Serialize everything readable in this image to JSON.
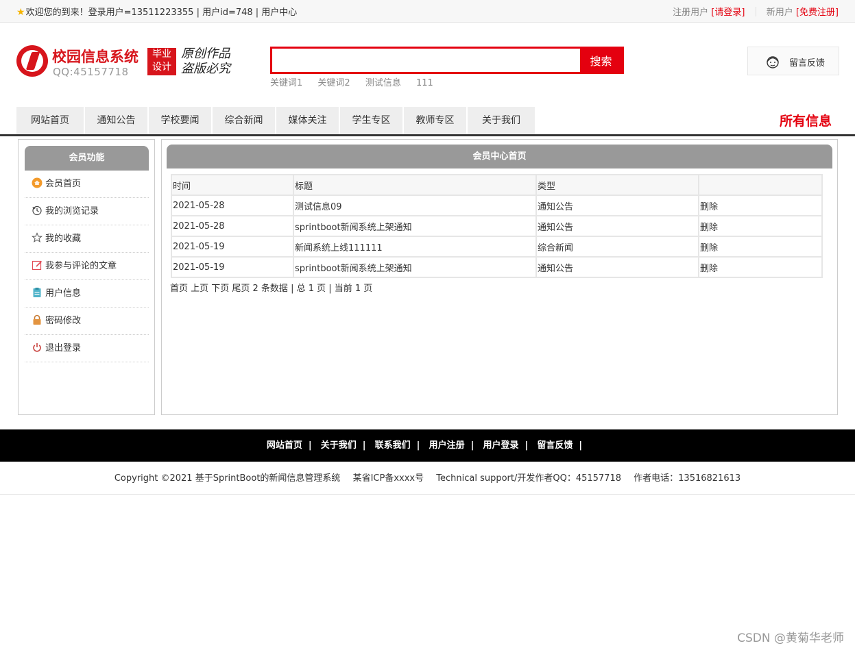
{
  "topbar": {
    "welcome": "欢迎您的到来！登录用户=13511223355 | 用户id=748 | 用户中心",
    "register_prefix": "注册用户",
    "register_link": "[请登录]",
    "new_user_prefix": "新用户",
    "new_user_link": "[免费注册]"
  },
  "header": {
    "logo_title": "校园信息系统",
    "logo_qq": "QQ:45157718",
    "badge_line1": "毕业",
    "badge_line2": "设计",
    "slogan_line1": "原创作品",
    "slogan_line2": "盗版必究",
    "search_value": "",
    "search_button": "搜索",
    "hotwords": [
      "关键词1",
      "关键词2",
      "测试信息",
      "111"
    ],
    "feedback_label": "留言反馈"
  },
  "nav": {
    "items": [
      "网站首页",
      "通知公告",
      "学校要闻",
      "综合新闻",
      "媒体关注",
      "学生专区",
      "教师专区",
      "关于我们"
    ],
    "all_info": "所有信息"
  },
  "sidebar": {
    "title": "会员功能",
    "items": [
      {
        "label": "会员首页",
        "icon": "home-icon"
      },
      {
        "label": "我的浏览记录",
        "icon": "history-icon"
      },
      {
        "label": "我的收藏",
        "icon": "star-icon"
      },
      {
        "label": "我参与评论的文章",
        "icon": "edit-icon"
      },
      {
        "label": "用户信息",
        "icon": "clipboard-icon"
      },
      {
        "label": "密码修改",
        "icon": "lock-icon"
      },
      {
        "label": "退出登录",
        "icon": "power-icon"
      }
    ]
  },
  "main": {
    "title": "会员中心首页",
    "columns": [
      "时间",
      "标题",
      "类型",
      ""
    ],
    "rows": [
      {
        "time": "2021-05-28",
        "title": "测试信息09",
        "type": "通知公告",
        "action": "删除"
      },
      {
        "time": "2021-05-28",
        "title": "sprintboot新闻系统上架通知",
        "type": "通知公告",
        "action": "删除"
      },
      {
        "time": "2021-05-19",
        "title": "新闻系统上线111111",
        "type": "综合新闻",
        "action": "删除"
      },
      {
        "time": "2021-05-19",
        "title": "sprintboot新闻系统上架通知",
        "type": "通知公告",
        "action": "删除"
      }
    ],
    "pager": "首页 上页 下页 尾页 2 条数据 | 总 1 页 | 当前 1 页"
  },
  "footer": {
    "links": [
      "网站首页",
      "关于我们",
      "联系我们",
      "用户注册",
      "用户登录",
      "留言反馈"
    ],
    "copyright": "Copyright ©2021 基于SprintBoot的新闻信息管理系统",
    "icp": "某省ICP备xxxx号",
    "support": "Technical support/开发作者QQ：45157718",
    "phone": "作者电话：13516821613"
  },
  "watermark": "CSDN @黄菊华老师",
  "colors": {
    "accent_red": "#e4000f",
    "brand_red": "#d7151c",
    "header_gray": "#999999"
  }
}
